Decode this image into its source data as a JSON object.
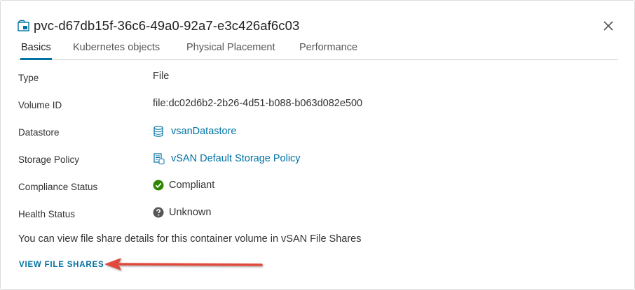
{
  "dialog": {
    "title": "pvc-d67db15f-36c6-49a0-92a7-e3c426af6c03",
    "title_icon": "volume-icon",
    "close_icon": "close-icon"
  },
  "tabs": [
    {
      "label": "Basics",
      "active": true
    },
    {
      "label": "Kubernetes objects",
      "active": false
    },
    {
      "label": "Physical Placement",
      "active": false
    },
    {
      "label": "Performance",
      "active": false
    }
  ],
  "details": {
    "type": {
      "label": "Type",
      "value": "File"
    },
    "volume_id": {
      "label": "Volume ID",
      "value": "file:dc02d6b2-2b26-4d51-b088-b063d082e500"
    },
    "datastore": {
      "label": "Datastore",
      "value": "vsanDatastore",
      "icon": "datastore-icon"
    },
    "storage_policy": {
      "label": "Storage Policy",
      "value": "vSAN Default Storage Policy",
      "icon": "storage-policy-icon"
    },
    "compliance_status": {
      "label": "Compliance Status",
      "value": "Compliant",
      "icon": "check-circle-icon"
    },
    "health_status": {
      "label": "Health Status",
      "value": "Unknown",
      "icon": "question-circle-icon"
    }
  },
  "info_text": "You can view file share details for this container volume in vSAN File Shares",
  "view_file_shares": "VIEW FILE SHARES",
  "colors": {
    "accent": "#0072a3",
    "success": "#2e8500",
    "unknown": "#565656",
    "annotation_arrow": "#e0483b"
  }
}
